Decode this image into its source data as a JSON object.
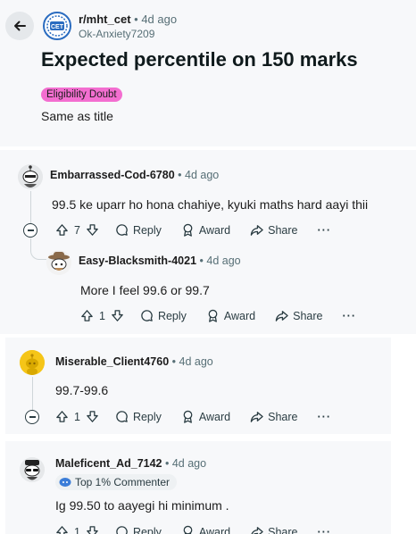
{
  "post": {
    "subreddit": "r/mht_cet",
    "age": "• 4d ago",
    "author": "Ok-Anxiety7209",
    "title": "Expected percentile on 150 marks",
    "flair": "Eligibility Doubt",
    "body": "Same as title",
    "logo_text": "CET"
  },
  "labels": {
    "reply": "Reply",
    "award": "Award",
    "share": "Share",
    "more": "···"
  },
  "comments": [
    {
      "user": "Embarrassed-Cod-6780",
      "age": "• 4d ago",
      "text": "99.5 ke uparr ho hona chahiye, kyuki maths hard aayi thii",
      "votes": "7"
    },
    {
      "user": "Easy-Blacksmith-4021",
      "age": "• 4d ago",
      "text": "More I feel 99.6 or 99.7",
      "votes": "1"
    },
    {
      "user": "Miserable_Client4760",
      "age": "• 4d ago",
      "text": "99.7-99.6",
      "votes": "1"
    },
    {
      "user": "Maleficent_Ad_7142",
      "age": "• 4d ago",
      "badge": "Top 1% Commenter",
      "text": "Ig 99.50 to aayegi hi minimum .",
      "votes": "1"
    }
  ],
  "colors": {
    "flair_bg": "#f36ed0",
    "panel_bg": "#f7f8fa",
    "logo_ring": "#2a6cc0"
  }
}
